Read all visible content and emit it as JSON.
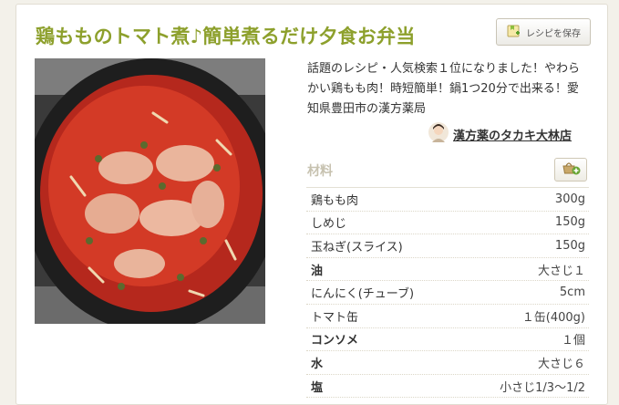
{
  "recipe": {
    "title": "鶏もものトマト煮♪簡単煮るだけ夕食お弁当",
    "save_label": "レシピを保存",
    "description": "話題のレシピ・人気検索１位になりました！やわらかい鶏もも肉！時短簡単！鍋1つ20分で出来る！愛知県豊田市の漢方薬局",
    "author": "漢方薬のタカキ大林店"
  },
  "ingredients": {
    "heading": "材料",
    "items": [
      {
        "name": "鶏もも肉",
        "qty": "300g"
      },
      {
        "name": "しめじ",
        "qty": "150g"
      },
      {
        "name": "玉ねぎ(スライス)",
        "qty": "150g"
      },
      {
        "name": "油",
        "qty": "大さじ１"
      },
      {
        "name": "にんにく(チューブ)",
        "qty": "5cm"
      },
      {
        "name": "トマト缶",
        "qty": "１缶(400g)"
      },
      {
        "name": "コンソメ",
        "qty": "１個"
      },
      {
        "name": "水",
        "qty": "大さじ６"
      },
      {
        "name": "塩",
        "qty": "小さじ1/3〜1/2"
      }
    ]
  },
  "colors": {
    "title": "#8da02c",
    "accent_green": "#6aa636"
  },
  "icons": {
    "save": "save-recipe-icon",
    "cart": "basket-add-icon"
  }
}
